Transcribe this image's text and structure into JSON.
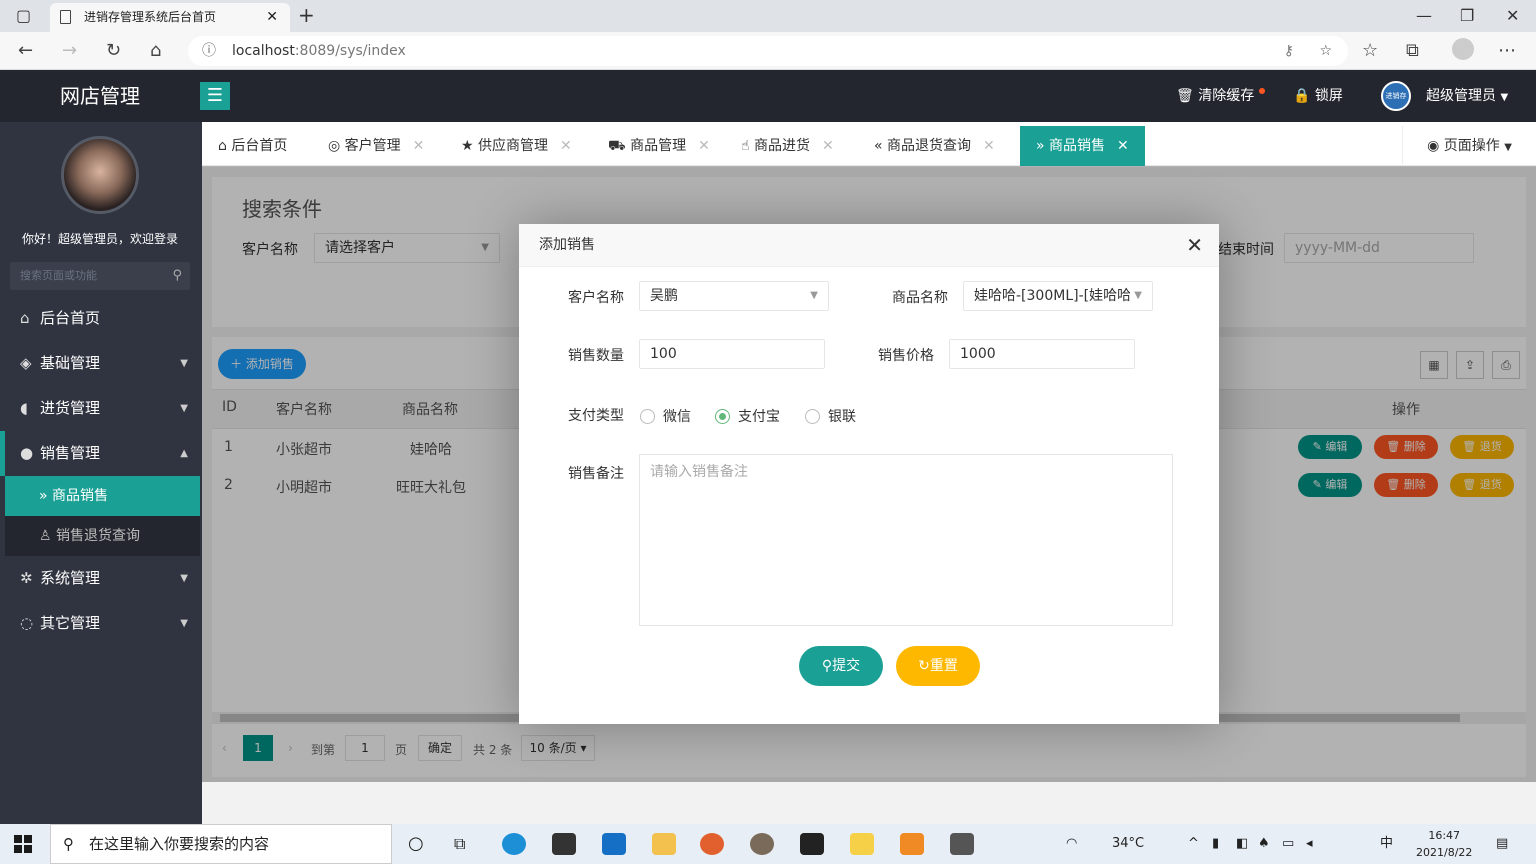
{
  "browser": {
    "tab_title": "进销存管理系统后台首页",
    "url_host": "localhost",
    "url_path": ":8089/sys/index"
  },
  "header": {
    "logo": "网店管理",
    "clear_cache": "清除缓存",
    "lock_screen": "锁屏",
    "avatar_text": "进销存",
    "user": "超级管理员"
  },
  "sidebar": {
    "welcome": "你好！超级管理员，欢迎登录",
    "search_placeholder": "搜索页面或功能",
    "items": [
      {
        "label": "后台首页"
      },
      {
        "label": "基础管理"
      },
      {
        "label": "进货管理"
      },
      {
        "label": "销售管理"
      },
      {
        "label": "商品销售"
      },
      {
        "label": "销售退货查询"
      },
      {
        "label": "系统管理"
      },
      {
        "label": "其它管理"
      }
    ]
  },
  "tabs": [
    {
      "label": "后台首页"
    },
    {
      "label": "客户管理"
    },
    {
      "label": "供应商管理"
    },
    {
      "label": "商品管理"
    },
    {
      "label": "商品进货"
    },
    {
      "label": "商品退货查询"
    },
    {
      "label": "商品销售"
    }
  ],
  "page_ops": "页面操作",
  "search": {
    "title": "搜索条件",
    "customer_label": "客户名称",
    "customer_placeholder": "请选择客户",
    "end_time_label": "结束时间",
    "end_time_placeholder": "yyyy-MM-dd"
  },
  "table": {
    "add_button": "添加销售",
    "headers": [
      "ID",
      "客户名称",
      "商品名称",
      "操作"
    ],
    "rows": [
      {
        "id": "1",
        "customer": "小张超市",
        "product": "娃哈哈"
      },
      {
        "id": "2",
        "customer": "小明超市",
        "product": "旺旺大礼包"
      }
    ],
    "actions": {
      "edit": "编辑",
      "delete": "删除",
      "return": "退货"
    }
  },
  "pager": {
    "current": "1",
    "goto_label": "到第",
    "goto_value": "1",
    "page_unit": "页",
    "confirm": "确定",
    "total": "共 2 条",
    "page_size": "10 条/页"
  },
  "modal": {
    "title": "添加销售",
    "customer_label": "客户名称",
    "customer_value": "吴鹏",
    "product_label": "商品名称",
    "product_value": "娃哈哈-[300ML]-[娃哈哈",
    "qty_label": "销售数量",
    "qty_value": "100",
    "price_label": "销售价格",
    "price_value": "1000",
    "pay_label": "支付类型",
    "pay_options": [
      "微信",
      "支付宝",
      "银联"
    ],
    "pay_selected": "支付宝",
    "remark_label": "销售备注",
    "remark_placeholder": "请输入销售备注",
    "submit": "提交",
    "reset": "重置"
  },
  "taskbar": {
    "search_placeholder": "在这里输入你要搜索的内容",
    "temperature": "34°C",
    "time": "16:47",
    "date": "2021/8/22"
  },
  "colors": {
    "accent": "#1aa094",
    "header_bg": "#23262e",
    "sidebar_bg": "#2f3440",
    "blue": "#1e9fff",
    "orange": "#ffb800",
    "red": "#ff5722"
  }
}
